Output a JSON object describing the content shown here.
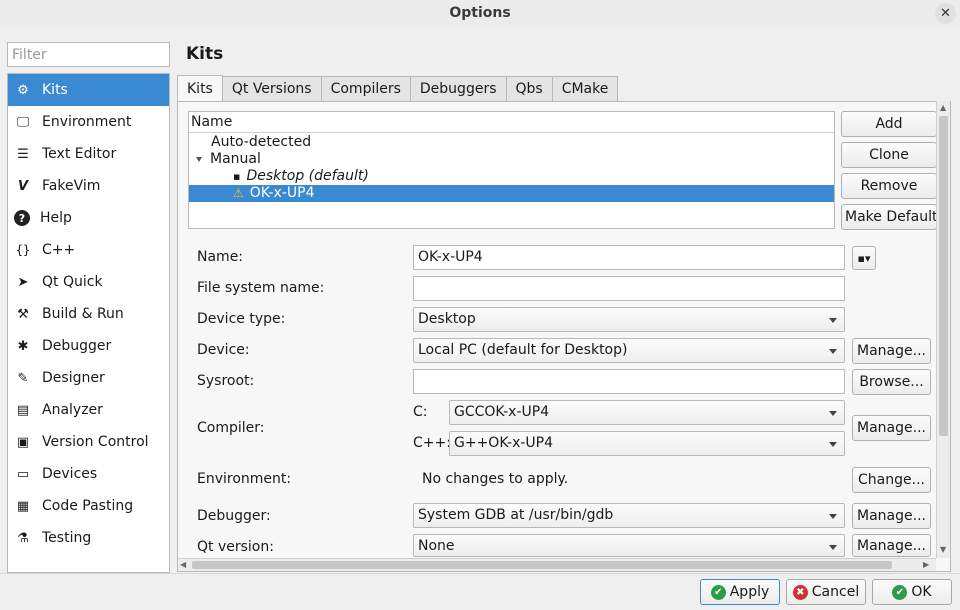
{
  "window": {
    "title": "Options",
    "close_glyph": "✕"
  },
  "filter": {
    "placeholder": "Filter"
  },
  "sidebar": {
    "items": [
      {
        "label": "Kits",
        "icon": "kits-icon",
        "glyph": "⚙"
      },
      {
        "label": "Environment",
        "icon": "monitor-icon",
        "glyph": "🖵"
      },
      {
        "label": "Text Editor",
        "icon": "text-editor-icon",
        "glyph": "☰"
      },
      {
        "label": "FakeVim",
        "icon": "fakevim-icon",
        "glyph": "V"
      },
      {
        "label": "Help",
        "icon": "help-icon",
        "glyph": "?"
      },
      {
        "label": "C++",
        "icon": "braces-icon",
        "glyph": "{}"
      },
      {
        "label": "Qt Quick",
        "icon": "qt-quick-icon",
        "glyph": "➤"
      },
      {
        "label": "Build & Run",
        "icon": "hammer-icon",
        "glyph": "⚒"
      },
      {
        "label": "Debugger",
        "icon": "bug-icon",
        "glyph": "✱"
      },
      {
        "label": "Designer",
        "icon": "pencil-icon",
        "glyph": "✎"
      },
      {
        "label": "Analyzer",
        "icon": "analyzer-icon",
        "glyph": "▤"
      },
      {
        "label": "Version Control",
        "icon": "version-control-icon",
        "glyph": "▣"
      },
      {
        "label": "Devices",
        "icon": "devices-icon",
        "glyph": "▭"
      },
      {
        "label": "Code Pasting",
        "icon": "code-pasting-icon",
        "glyph": "▦"
      },
      {
        "label": "Testing",
        "icon": "testing-icon",
        "glyph": "⚗"
      }
    ]
  },
  "page": {
    "title": "Kits"
  },
  "tabs": [
    "Kits",
    "Qt Versions",
    "Compilers",
    "Debuggers",
    "Qbs",
    "CMake"
  ],
  "kit_tree": {
    "header": "Name",
    "auto_detected": "Auto-detected",
    "manual": "Manual",
    "desktop": "Desktop (default)",
    "selected_kit": "OK-x-UP4"
  },
  "kit_buttons": {
    "add": "Add",
    "clone": "Clone",
    "remove": "Remove",
    "make_default": "Make Default"
  },
  "form": {
    "name_label": "Name:",
    "name_value": "OK-x-UP4",
    "fs_name_label": "File system name:",
    "fs_name_value": "",
    "device_type_label": "Device type:",
    "device_type_value": "Desktop",
    "device_label": "Device:",
    "device_value": "Local PC (default for Desktop)",
    "sysroot_label": "Sysroot:",
    "sysroot_value": "",
    "compiler_label": "Compiler:",
    "c_label": "C:",
    "c_value": "GCCOK-x-UP4",
    "cxx_label": "C++:",
    "cxx_value": "G++OK-x-UP4",
    "environment_label": "Environment:",
    "environment_value": "No changes to apply.",
    "debugger_label": "Debugger:",
    "debugger_value": "System GDB at /usr/bin/gdb",
    "qt_version_label": "Qt version:",
    "qt_version_value": "None",
    "manage": "Manage...",
    "browse": "Browse...",
    "change": "Change..."
  },
  "dialog_buttons": {
    "apply": "Apply",
    "cancel": "Cancel",
    "ok": "OK"
  },
  "colors": {
    "selection": "#3a8ad3",
    "ok_green": "#2e9b48",
    "cancel_red": "#d0342c"
  }
}
